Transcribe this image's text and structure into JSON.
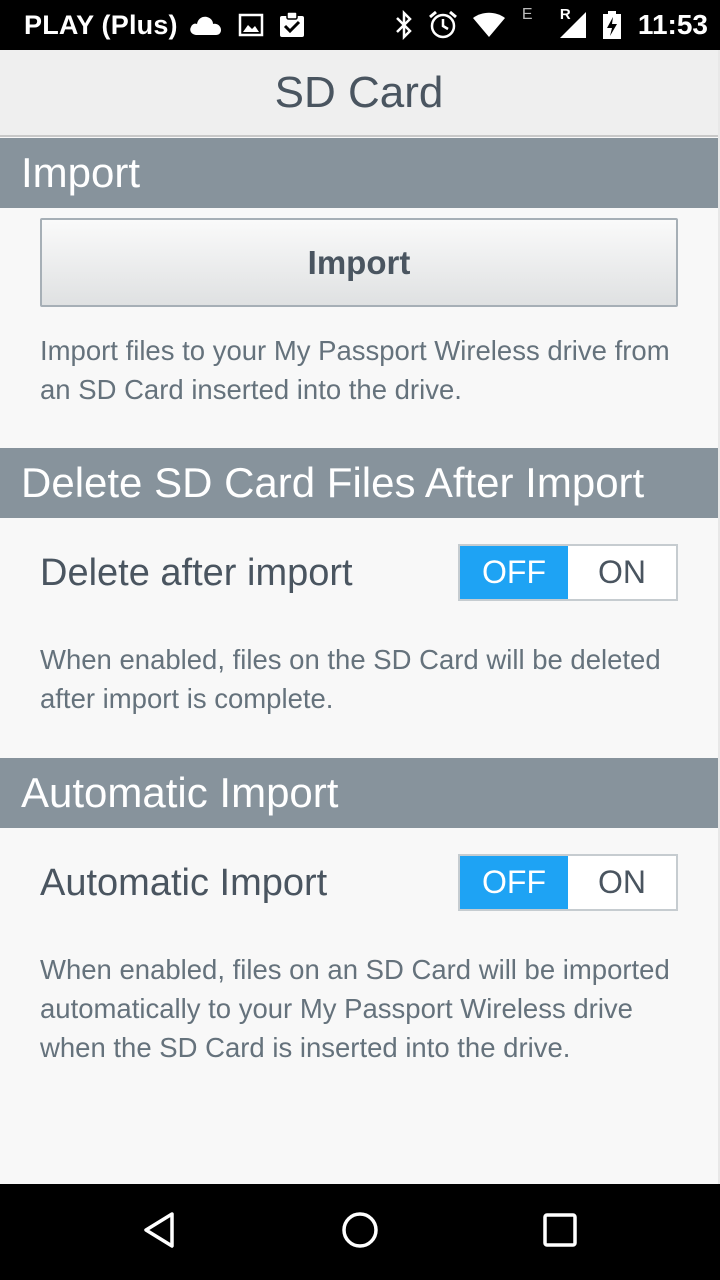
{
  "status_bar": {
    "carrier": "PLAY (Plus)",
    "network_type": "E",
    "roaming_indicator": "R",
    "time": "11:53",
    "left_icons": [
      "cloud-icon",
      "image-icon",
      "clipboard-check-icon"
    ],
    "right_icons": [
      "bluetooth-icon",
      "alarm-icon",
      "wifi-icon",
      "signal-icon",
      "battery-charging-icon"
    ]
  },
  "title": "SD Card",
  "sections": {
    "import": {
      "header": "Import",
      "button_label": "Import",
      "description": "Import files to your My Passport Wireless drive from an SD Card inserted into the drive."
    },
    "delete_after_import": {
      "header": "Delete SD Card Files After Import",
      "label": "Delete after import",
      "toggle": {
        "off_label": "OFF",
        "on_label": "ON",
        "selected": "OFF"
      },
      "description": "When enabled, files on the SD Card will be deleted after import is complete."
    },
    "automatic_import": {
      "header": "Automatic Import",
      "label": "Automatic Import",
      "toggle": {
        "off_label": "OFF",
        "on_label": "ON",
        "selected": "OFF"
      },
      "description": "When enabled, files on an SD Card will be imported automatically to your My Passport Wireless drive when the SD Card is inserted into the drive."
    }
  },
  "nav_bar": {
    "buttons": [
      "back-icon",
      "home-icon",
      "recents-icon"
    ]
  },
  "colors": {
    "section_header_bg": "#87939c",
    "toggle_active": "#1ea3f4",
    "text_primary": "#4a5560"
  }
}
